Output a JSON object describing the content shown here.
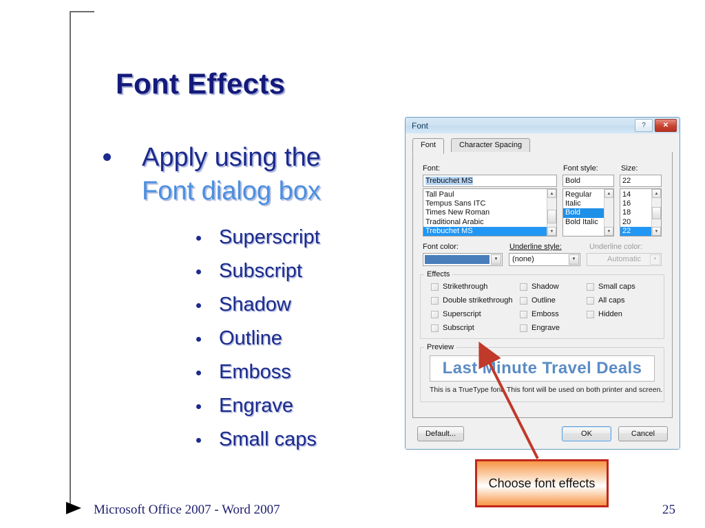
{
  "slide": {
    "title": "Font Effects",
    "bullet": {
      "line1": "Apply using the",
      "line2": "Font dialog box"
    },
    "sub_bullets": [
      "Superscript",
      "Subscript",
      "Shadow",
      "Outline",
      "Emboss",
      "Engrave",
      "Small caps"
    ],
    "footer": "Microsoft Office 2007 - Word 2007",
    "page_number": "25",
    "callout": "Choose font effects",
    "colors": {
      "title": "#131a7a",
      "bullet_line1": "#1b2a8c",
      "bullet_line2": "#4c8fe0",
      "callout_border": "#c0261c",
      "callout_fill": "#f79646",
      "arrow": "#c0392b",
      "footer_text": "#1d1d6e"
    }
  },
  "dialog": {
    "title": "Font",
    "help_button": "?",
    "close_button": "✕",
    "tabs": [
      {
        "label": "Font",
        "active": true
      },
      {
        "label": "Character Spacing",
        "active": false
      }
    ],
    "font_section": {
      "font_label": "Font:",
      "font_value": "Trebuchet MS",
      "font_list": [
        "Tall Paul",
        "Tempus Sans ITC",
        "Times New Roman",
        "Traditional Arabic",
        "Trebuchet MS"
      ],
      "font_selected": "Trebuchet MS",
      "style_label": "Font style:",
      "style_value": "Bold",
      "style_list": [
        "Regular",
        "Italic",
        "Bold",
        "Bold Italic"
      ],
      "style_selected": "Bold",
      "size_label": "Size:",
      "size_value": "22",
      "size_list": [
        "14",
        "16",
        "18",
        "20",
        "22"
      ],
      "size_selected": "22"
    },
    "color_row": {
      "font_color_label": "Font color:",
      "font_color_value": "#4a7ebb",
      "underline_style_label": "Underline style:",
      "underline_style_value": "(none)",
      "underline_color_label": "Underline color:",
      "underline_color_value": "Automatic"
    },
    "effects": {
      "caption": "Effects",
      "col1": [
        {
          "label": "Strikethrough",
          "checked": false
        },
        {
          "label": "Double strikethrough",
          "checked": false
        },
        {
          "label": "Superscript",
          "checked": false
        },
        {
          "label": "Subscript",
          "checked": false
        }
      ],
      "col2": [
        {
          "label": "Shadow",
          "checked": false
        },
        {
          "label": "Outline",
          "checked": false
        },
        {
          "label": "Emboss",
          "checked": false
        },
        {
          "label": "Engrave",
          "checked": false
        }
      ],
      "col3": [
        {
          "label": "Small caps",
          "checked": false
        },
        {
          "label": "All caps",
          "checked": false
        },
        {
          "label": "Hidden",
          "checked": false
        }
      ]
    },
    "preview": {
      "caption": "Preview",
      "sample_text": "Last Minute Travel Deals",
      "note": "This is a TrueType font. This font will be used on both printer and screen."
    },
    "buttons": {
      "default": "Default...",
      "ok": "OK",
      "cancel": "Cancel"
    }
  }
}
